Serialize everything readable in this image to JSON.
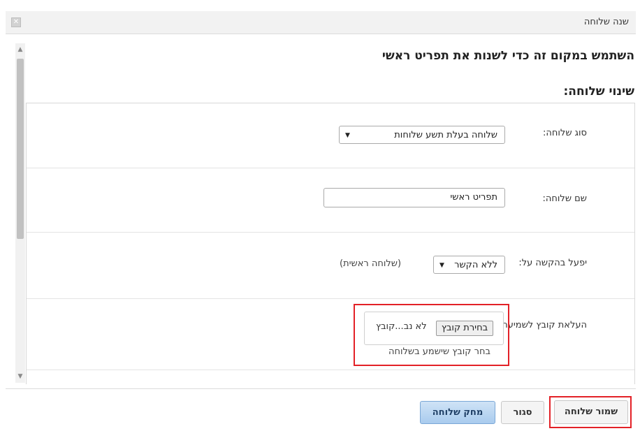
{
  "dialog": {
    "title": "שנה שלוחה"
  },
  "header": {
    "heading": "השתמש במקום זה כדי לשנות את תפריט ראשי",
    "subheading": "שינוי שלוחה:"
  },
  "form": {
    "type": {
      "label": "סוג שלוחה:",
      "value": "שלוחה בעלת תשע שלוחות"
    },
    "name": {
      "label": "שם שלוחה:",
      "value": "תפריט ראשי"
    },
    "activate": {
      "label": "יפעל בהקשה על:",
      "value": "ללא הקשר",
      "hint": "(שלוחה ראשית)"
    },
    "upload": {
      "label": "העלאת קובץ לשמיעה:",
      "button_label": "בחירת קובץ",
      "status": "לא נב...קובץ",
      "hint": "בחר קובץ שישמע בשלוחה"
    }
  },
  "footer": {
    "save_label": "שמור שלוחה",
    "close_label": "סגור",
    "delete_label": "מחק שלוחה"
  },
  "colors": {
    "highlight": "#e32127",
    "primary_button": "#a9cbee"
  }
}
